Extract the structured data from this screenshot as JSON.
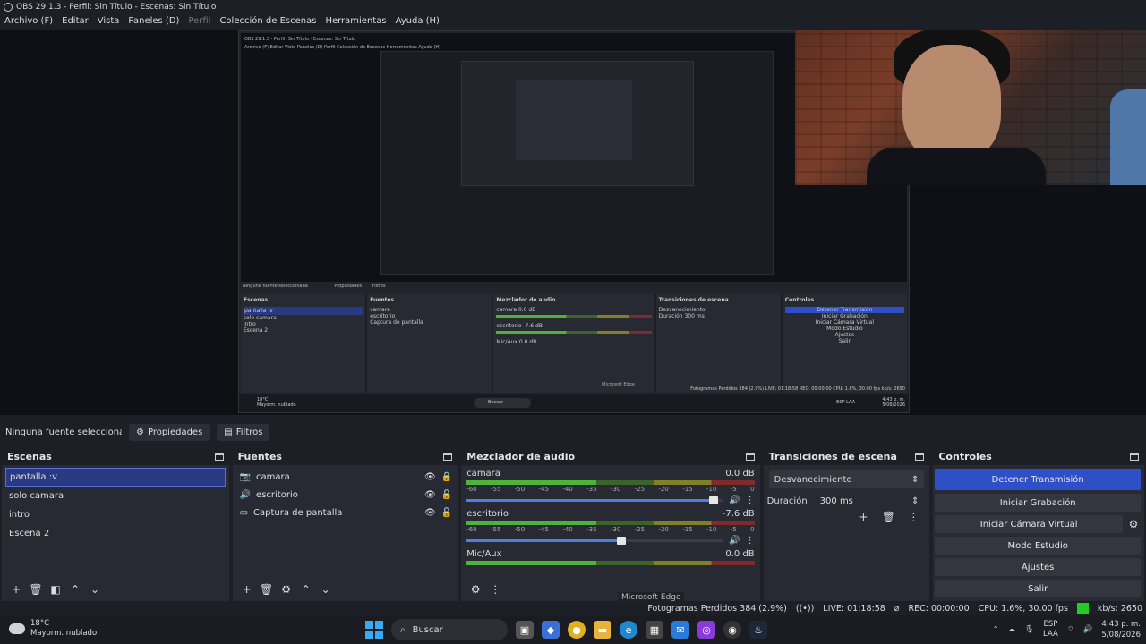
{
  "window": {
    "title": "OBS 29.1.3 - Perfil: Sin Título - Escenas: Sin Título"
  },
  "menu": [
    {
      "label": "Archivo (F)",
      "disabled": false
    },
    {
      "label": "Editar",
      "disabled": false
    },
    {
      "label": "Vista",
      "disabled": false
    },
    {
      "label": "Paneles (D)",
      "disabled": false
    },
    {
      "label": "Perfil",
      "disabled": true
    },
    {
      "label": "Colección de Escenas",
      "disabled": false
    },
    {
      "label": "Herramientas",
      "disabled": false
    },
    {
      "label": "Ayuda (H)",
      "disabled": false
    }
  ],
  "properties_bar": {
    "no_source": "Ninguna fuente seleccionada",
    "properties": "Propiedades",
    "filters": "Filtros"
  },
  "scenes": {
    "title": "Escenas",
    "items": [
      "pantalla :v",
      "solo camara",
      "intro",
      "Escena 2"
    ]
  },
  "sources": {
    "title": "Fuentes",
    "items": [
      {
        "name": "camara",
        "icon": "camera-icon"
      },
      {
        "name": "escritorio",
        "icon": "speaker-icon"
      },
      {
        "name": "Captura de pantalla",
        "icon": "monitor-icon"
      }
    ]
  },
  "mixer": {
    "title": "Mezclador de audio",
    "scale": [
      "-60",
      "-55",
      "-50",
      "-45",
      "-40",
      "-35",
      "-30",
      "-25",
      "-20",
      "-15",
      "-10",
      "-5",
      "0"
    ],
    "channels": [
      {
        "name": "camara",
        "db": "0.0 dB",
        "level": 0.98
      },
      {
        "name": "escritorio",
        "db": "-7.6 dB",
        "level": 0.62
      },
      {
        "name": "Mic/Aux",
        "db": "0.0 dB",
        "level": 0.98
      }
    ]
  },
  "transitions": {
    "title": "Transiciones de escena",
    "selected": "Desvanecimiento",
    "duration_label": "Duración",
    "duration_value": "300 ms"
  },
  "controls": {
    "title": "Controles",
    "stop_stream": "Detener Transmisión",
    "start_record": "Iniciar Grabación",
    "start_virtualcam": "Iniciar Cámara Virtual",
    "studio_mode": "Modo Estudio",
    "settings": "Ajustes",
    "exit": "Salir"
  },
  "status": {
    "dropped": "Fotogramas Perdidos 384 (2.9%)",
    "live": "LIVE: 01:18:58",
    "rec": "REC: 00:00:00",
    "cpu": "CPU: 1.6%, 30.00 fps",
    "kbps": "kb/s: 2650"
  },
  "tooltip": "Microsoft Edge",
  "taskbar": {
    "weather_temp": "18°C",
    "weather_desc": "Mayorm. nublado",
    "search": "Buscar",
    "lang1": "ESP",
    "lang2": "LAA",
    "time": "4:43 p. m.",
    "date": "5/08/2026"
  },
  "nested": {
    "title": "OBS 29.1.3 - Perfil: Sin Título - Escenas: Sin Título",
    "menu": "Archivo (F)   Editar   Vista   Paneles (D)   Perfil   Colección de Escenas   Herramientas   Ayuda (H)",
    "no_source": "Ninguna fuente seleccionada",
    "properties": "Propiedades",
    "filters": "Filtros",
    "scenes_title": "Escenas",
    "scenes": [
      "pantalla :v",
      "solo camara",
      "intro",
      "Escena 2"
    ],
    "sources_title": "Fuentes",
    "sources": [
      "camara",
      "escritorio",
      "Captura de pantalla"
    ],
    "mixer_title": "Mezclador de audio",
    "mixer": [
      "camara 0.0 dB",
      "escritorio -7.6 dB",
      "Mic/Aux 0.0 dB"
    ],
    "transitions_title": "Transiciones de escena",
    "transitions": [
      "Desvanecimiento",
      "Duración 300 ms"
    ],
    "controls_title": "Controles",
    "controls": [
      "Detener Transmisión",
      "Iniciar Grabación",
      "Iniciar Cámara Virtual",
      "Modo Estudio",
      "Ajustes",
      "Salir"
    ],
    "status": "Fotogramas Perdidos 384 (2.9%)   LIVE: 01:18:58   REC: 00:00:00   CPU: 1.6%, 30.00 fps   kb/s: 2650",
    "tooltip": "Microsoft Edge",
    "weather_temp": "18°C",
    "weather_desc": "Mayorm. nublado",
    "search": "Buscar",
    "lang": "ESP LAA",
    "time": "4:43 p. m.",
    "date": "5/08/2026"
  },
  "colors": {
    "accent": "#2f4fc7",
    "selection": "#2a3a82",
    "live_green": "#22cc22"
  }
}
